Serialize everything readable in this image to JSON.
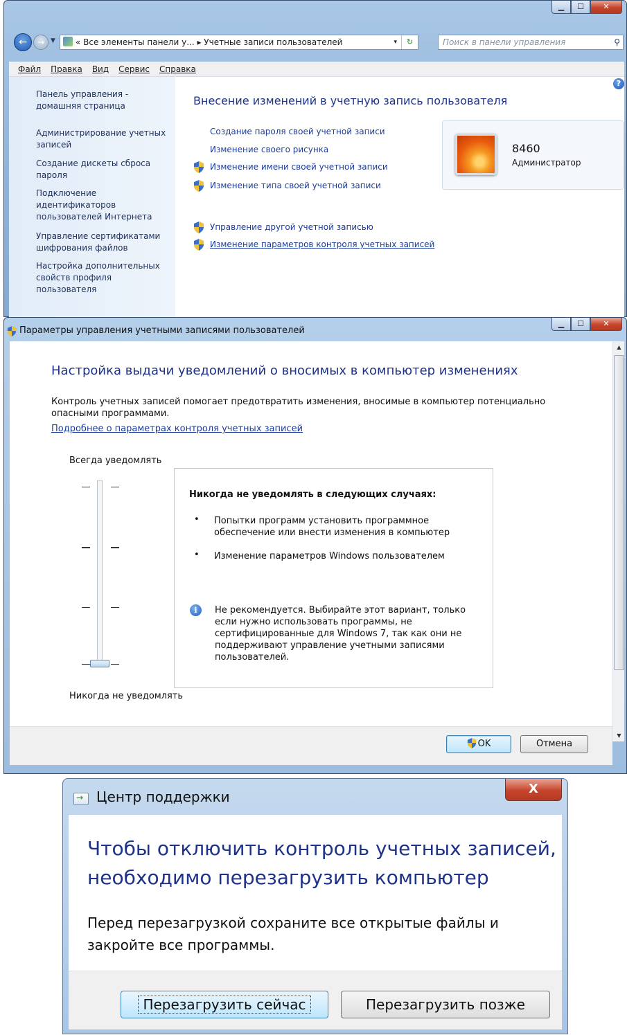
{
  "control_panel": {
    "nav": {
      "back_glyph": "←",
      "forward_glyph": "→"
    },
    "address": {
      "text": "« Все элементы панели у... ▸ Учетные записи пользователей",
      "dropdown": "▾",
      "refresh": "↻"
    },
    "search": {
      "placeholder": "Поиск в панели управления",
      "icon": "⚲"
    },
    "window_buttons": {
      "minimize": "▁",
      "maximize": "☐",
      "close": "✕"
    },
    "menu": [
      "Файл",
      "Правка",
      "Вид",
      "Сервис",
      "Справка"
    ],
    "sidebar": [
      "Панель управления - домашняя страница",
      "Администрирование учетных записей",
      "Создание дискеты сброса пароля",
      "Подключение идентификаторов пользователей Интернета",
      "Управление сертификатами шифрования файлов",
      "Настройка дополнительных свойств профиля пользователя"
    ],
    "title": "Внесение изменений в учетную запись пользователя",
    "links": [
      "Создание пароля своей учетной записи",
      "Изменение своего рисунка",
      "Изменение имени своей учетной записи",
      "Изменение типа своей учетной записи",
      "Управление другой учетной записью",
      "Изменение параметров контроля учетных записей"
    ],
    "user": {
      "name": "8460",
      "role": "Администратор"
    },
    "help_icon": "?"
  },
  "uac_settings": {
    "window_title": "Параметры управления учетными записями пользователей",
    "heading": "Настройка выдачи уведомлений о вносимых в компьютер изменениях",
    "description": "Контроль учетных записей помогает предотвратить изменения, вносимые в компьютер потенциально опасными программами.",
    "more_link": "Подробнее о параметрах контроля учетных записей",
    "slider_top_label": "Всегда уведомлять",
    "slider_bottom_label": "Никогда не уведомлять",
    "slider_level": "4 of 4 (lowest position)",
    "info_title": "Никогда не уведомлять в следующих случаях:",
    "bullets": [
      "Попытки программ установить программное обеспечение или внести изменения в компьютер",
      "Изменение параметров Windows пользователем"
    ],
    "note": "Не рекомендуется. Выбирайте этот вариант, только если нужно использовать программы, не сертифицированные для Windows 7, так как они не поддерживают управление учетными записями пользователей.",
    "ok_label": "OK",
    "cancel_label": "Отмена",
    "scroll_up": "▲",
    "scroll_down": "▼"
  },
  "action_center": {
    "title": "Центр поддержки",
    "close": "X",
    "heading": "Чтобы отключить контроль учетных записей, необходимо перезагрузить компьютер",
    "text": "Перед перезагрузкой сохраните все открытые файлы и закройте все программы.",
    "restart_now": "Перезагрузить сейчас",
    "restart_later": "Перезагрузить позже"
  },
  "colors": {
    "link": "#1c3c9c",
    "heading": "#1e3287",
    "titlebar": "#9dbde0"
  }
}
